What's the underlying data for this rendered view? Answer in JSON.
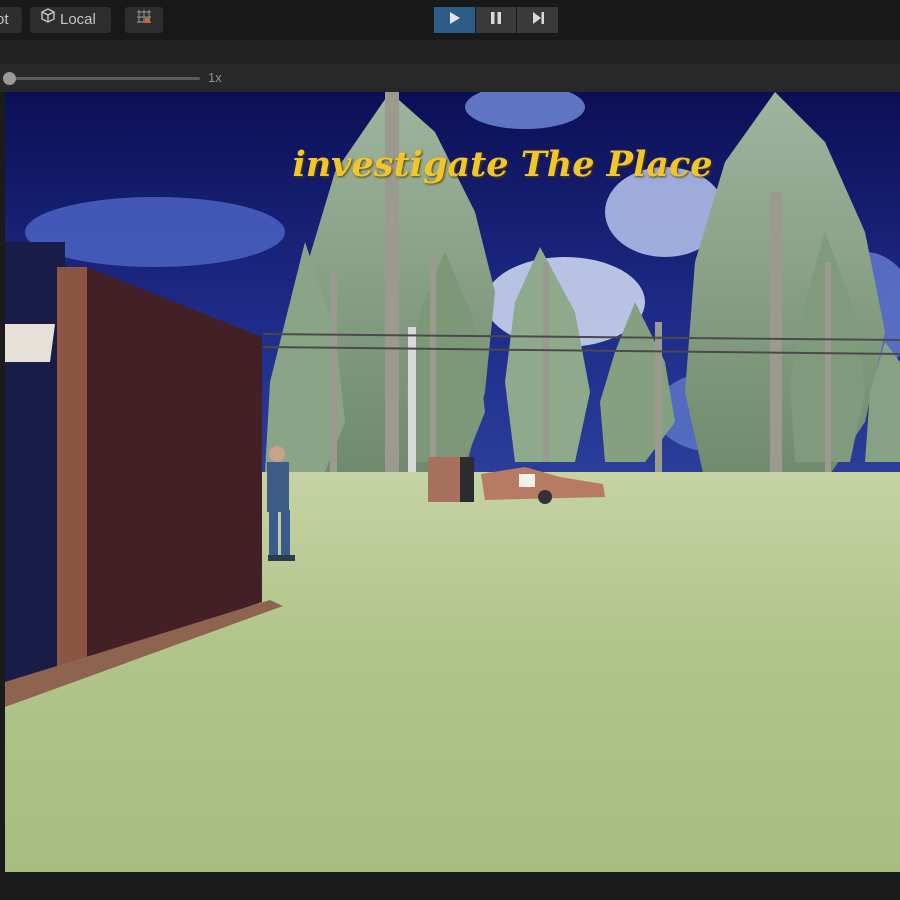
{
  "toolbar": {
    "partial_label": "ot",
    "pivot_mode_label": "Local",
    "pivot_mode_icon": "cube-icon",
    "grid_icon": "grid-snap-icon",
    "play_icon": "play-icon",
    "pause_icon": "pause-icon",
    "step_icon": "step-icon",
    "accent_color": "#2c5d87"
  },
  "timescale": {
    "label": "1x"
  },
  "game": {
    "objective_text": "investigate The Place",
    "objective_color": "#f0c62c"
  }
}
